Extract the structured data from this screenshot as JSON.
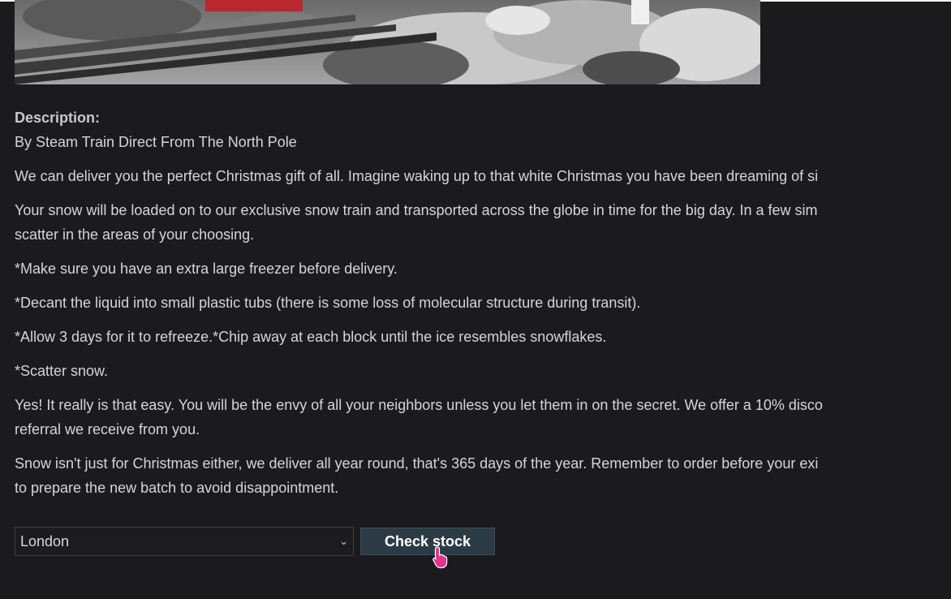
{
  "description": {
    "label": "Description:",
    "subtitle": "By Steam Train Direct From The North Pole",
    "paragraphs": [
      "We can deliver you the perfect Christmas gift of all. Imagine waking up to that white Christmas you have been dreaming of si",
      "Your snow will be loaded on to our exclusive snow train and transported across the globe in time for the big day. In a few sim",
      "scatter in the areas of your choosing.",
      "*Make sure you have an extra large freezer before delivery.",
      "*Decant the liquid into small plastic tubs (there is some loss of molecular structure during transit).",
      "*Allow 3 days for it to refreeze.*Chip away at each block until the ice resembles snowflakes.",
      "*Scatter snow.",
      "Yes! It really is that easy. You will be the envy of all your neighbors unless you let them in on the secret. We offer a 10% disco",
      "referral we receive from you.",
      "Snow isn't just for Christmas either, we deliver all year round, that's 365 days of the year. Remember to order before your exi",
      "to prepare the new batch to avoid disappointment."
    ]
  },
  "stock": {
    "selected_location": "London",
    "check_button_label": "Check stock"
  },
  "icons": {
    "dropdown": "chevron-down-icon",
    "cursor": "hand-pointer-icon"
  },
  "colors": {
    "background": "#1b1b1d",
    "button_bg": "#2b3b46",
    "cursor": "#e0338a"
  }
}
